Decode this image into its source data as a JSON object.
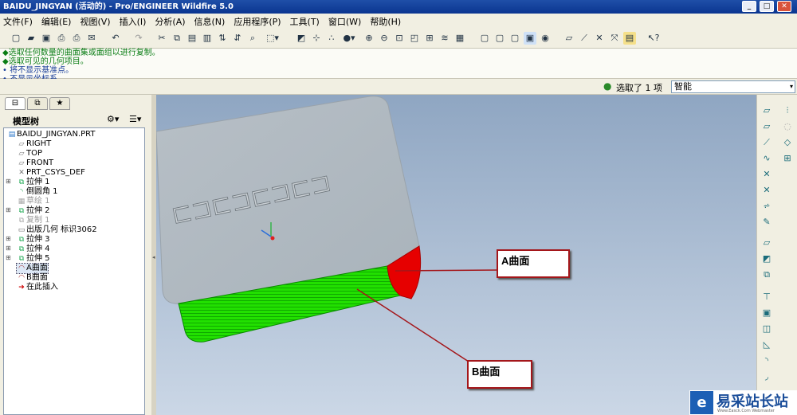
{
  "window": {
    "title": "BAIDU_JINGYAN (活动的) - Pro/ENGINEER Wildfire 5.0",
    "minimize_icon": "minimize-icon",
    "maximize_icon": "maximize-icon",
    "close_icon": "close-icon"
  },
  "menu": [
    "文件(F)",
    "编辑(E)",
    "视图(V)",
    "插入(I)",
    "分析(A)",
    "信息(N)",
    "应用程序(P)",
    "工具(T)",
    "窗口(W)",
    "帮助(H)"
  ],
  "messages": [
    "◆选取任何数量的曲面集或面组以进行复制。",
    "◆选取可见的几何项目。",
    "• 将不显示基准点。",
    "• 不显示坐标系。"
  ],
  "selection": {
    "status": "选取了 1 项",
    "filter": "智能"
  },
  "model_tree": {
    "title": "模型树",
    "items": [
      {
        "label": "BAIDU_JINGYAN.PRT",
        "icon": "part-icon"
      },
      {
        "label": "RIGHT",
        "icon": "datum-plane-icon"
      },
      {
        "label": "TOP",
        "icon": "datum-plane-icon"
      },
      {
        "label": "FRONT",
        "icon": "datum-plane-icon"
      },
      {
        "label": "PRT_CSYS_DEF",
        "icon": "csys-icon"
      },
      {
        "label": "拉伸 1",
        "icon": "extrude-icon"
      },
      {
        "label": "倒圆角 1",
        "icon": "round-icon"
      },
      {
        "label": "草绘 1",
        "icon": "sketch-icon"
      },
      {
        "label": "拉伸 2",
        "icon": "extrude-icon"
      },
      {
        "label": "复制 1",
        "icon": "copy-icon"
      },
      {
        "label": "出版几何 标识3062",
        "icon": "publish-geom-icon"
      },
      {
        "label": "拉伸 3",
        "icon": "extrude-icon"
      },
      {
        "label": "拉伸 4",
        "icon": "extrude-icon"
      },
      {
        "label": "拉伸 5",
        "icon": "extrude-icon"
      },
      {
        "label": "A曲面",
        "icon": "surface-icon"
      },
      {
        "label": "B曲面",
        "icon": "surface-icon"
      },
      {
        "label": "在此插入",
        "icon": "insert-here-icon"
      }
    ]
  },
  "callouts": {
    "a": "A曲面",
    "b": "B曲面"
  },
  "watermark": {
    "text": "易采站长站",
    "sub": "Www.Easck.Com Webmaster"
  },
  "colors": {
    "title_bar": "#0a3590",
    "highlight_green": "#22e000",
    "highlight_red": "#e60000",
    "callout_border": "#a4161a"
  }
}
